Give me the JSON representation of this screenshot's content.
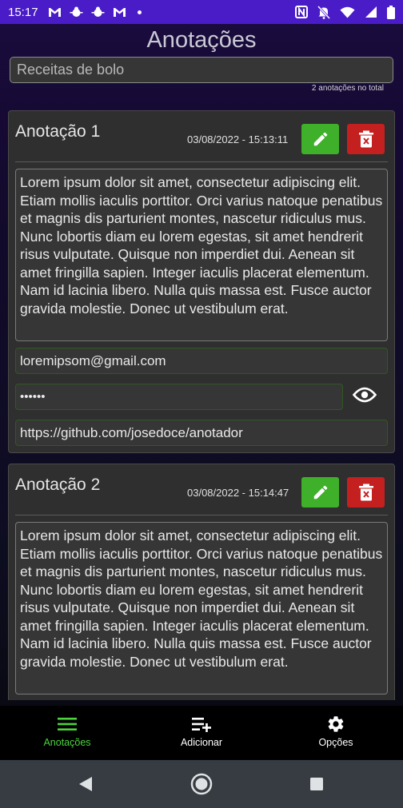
{
  "status_bar": {
    "time": "15:17"
  },
  "app": {
    "title": "Anotações"
  },
  "search": {
    "value": "Receitas de bolo"
  },
  "total_label": "2 anotações no total",
  "notes": [
    {
      "title": "Anotação 1",
      "date": "03/08/2022 - 15:13:11",
      "text": "Lorem ipsum dolor sit amet, consectetur adipiscing elit. Etiam mollis iaculis porttitor. Orci varius natoque penatibus et magnis dis parturient montes, nascetur ridiculus mus. Nunc lobortis diam eu lorem egestas, sit amet hendrerit risus vulputate. Quisque non imperdiet dui. Aenean sit amet fringilla sapien. Integer iaculis placerat elementum. Nam id lacinia libero. Nulla quis massa est. Fusce auctor gravida molestie. Donec ut vestibulum erat.",
      "email": "loremipsom@gmail.com",
      "password_masked": "••••••",
      "url": "https://github.com/josedoce/anotador"
    },
    {
      "title": "Anotação 2",
      "date": "03/08/2022 - 15:14:47",
      "text": "Lorem ipsum dolor sit amet, consectetur adipiscing elit. Etiam mollis iaculis porttitor. Orci varius natoque penatibus et magnis dis parturient montes, nascetur ridiculus mus. Nunc lobortis diam eu lorem egestas, sit amet hendrerit risus vulputate. Quisque non imperdiet dui. Aenean sit amet fringilla sapien. Integer iaculis placerat elementum. Nam id lacinia libero. Nulla quis massa est. Fusce auctor gravida molestie. Donec ut vestibulum erat."
    }
  ],
  "bottom_nav": {
    "items": [
      {
        "label": "Anotações",
        "icon": "menu-icon",
        "active": true
      },
      {
        "label": "Adicionar",
        "icon": "playlist-add-icon",
        "active": false
      },
      {
        "label": "Opções",
        "icon": "gear-icon",
        "active": false
      }
    ]
  },
  "colors": {
    "status_bar": "#4a1cc8",
    "edit_button": "#3fb02a",
    "delete_button": "#c42020",
    "active_nav": "#4cd23c",
    "card_bg": "#2f2f2f"
  }
}
